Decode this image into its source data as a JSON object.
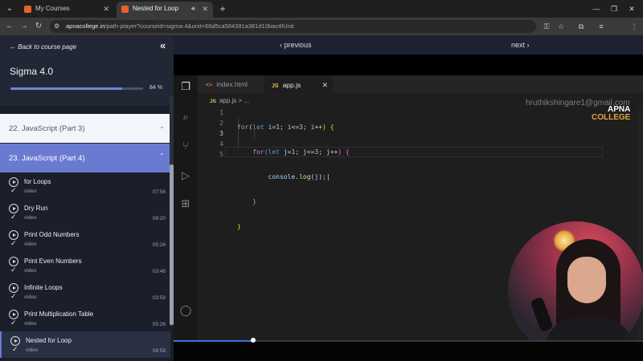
{
  "browser": {
    "tabs": [
      {
        "label": "My Courses",
        "active": false
      },
      {
        "label": "Nested for Loop",
        "active": true
      }
    ],
    "url_host": "apnacollege.in",
    "url_rest": "/path-player?courseid=sigma-4&unit=66d5ca584391a381d10bac4fUnit"
  },
  "sidebar": {
    "back_label": "← Back to course page",
    "course_title": "Sigma 4.0",
    "progress_percent": 84,
    "progress_label": "84 %",
    "sections": [
      {
        "label": "22. JavaScript (Part 3)",
        "expanded": false
      },
      {
        "label": "23. JavaScript (Part 4)",
        "expanded": true
      }
    ],
    "lessons": [
      {
        "title": "for Loops",
        "type": "video",
        "duration": "07:56"
      },
      {
        "title": "Dry Run",
        "type": "video",
        "duration": "09:20"
      },
      {
        "title": "Print Odd Numbers",
        "type": "video",
        "duration": "05:26"
      },
      {
        "title": "Print Even Numbers",
        "type": "video",
        "duration": "03:48"
      },
      {
        "title": "Infinite Loops",
        "type": "video",
        "duration": "03:59"
      },
      {
        "title": "Print Multiplication Table",
        "type": "video",
        "duration": "05:26"
      },
      {
        "title": "Nested for Loop",
        "type": "video",
        "duration": "08:58"
      }
    ]
  },
  "player": {
    "previous_label": "‹ previous",
    "next_label": "next ›",
    "progress_fraction": 0.17
  },
  "editor": {
    "tabs": [
      {
        "label": "index.html",
        "icon": "<>"
      },
      {
        "label": "app.js",
        "icon": "JS"
      }
    ],
    "breadcrumb_icon": "JS",
    "breadcrumb": "app.js > ...",
    "line_numbers": [
      "1",
      "2",
      "3",
      "4",
      "5"
    ],
    "watermark": "hruthikshingare1@gmail.com",
    "logo_line1": "APNA",
    "logo_line2": "COLLEGE"
  },
  "colors": {
    "accent": "#6a7ad1",
    "progress": "#6f86d8",
    "video_progress": "#3b73e0"
  }
}
